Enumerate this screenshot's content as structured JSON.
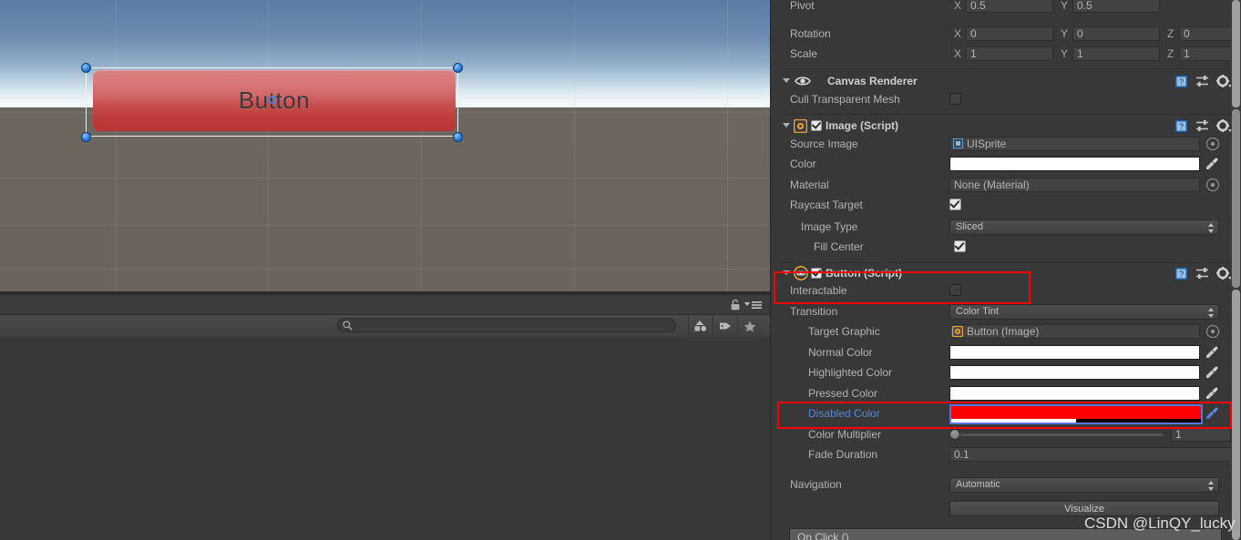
{
  "scene": {
    "object_label": "Button"
  },
  "project_panel": {
    "search_placeholder": "",
    "icons": {
      "search": "search-icon",
      "lock": "lock-icon",
      "menu": "hamburger-menu-icon",
      "filter_object": "filter-by-type-icon",
      "filter_label": "filter-by-label-icon",
      "filter_favorite": "favorite-star-icon"
    }
  },
  "inspector": {
    "transform": {
      "rows": [
        {
          "label": "Pivot",
          "fields": [
            {
              "axis": "X",
              "value": "0.5"
            },
            {
              "axis": "Y",
              "value": "0.5"
            }
          ]
        },
        {
          "label": "Rotation",
          "fields": [
            {
              "axis": "X",
              "value": "0"
            },
            {
              "axis": "Y",
              "value": "0"
            },
            {
              "axis": "Z",
              "value": "0"
            }
          ]
        },
        {
          "label": "Scale",
          "fields": [
            {
              "axis": "X",
              "value": "1"
            },
            {
              "axis": "Y",
              "value": "1"
            },
            {
              "axis": "Z",
              "value": "1"
            }
          ]
        }
      ]
    },
    "canvas_renderer": {
      "title": "Canvas Renderer",
      "icon": "eye-icon",
      "cull_transparent_mesh": {
        "label": "Cull Transparent Mesh",
        "checked": false
      }
    },
    "image_script": {
      "title": "Image (Script)",
      "enabled": true,
      "source_image": {
        "label": "Source Image",
        "value": "UISprite",
        "icon": "sprite-icon"
      },
      "color": {
        "label": "Color",
        "value": "#FFFFFF"
      },
      "material": {
        "label": "Material",
        "value": "None (Material)"
      },
      "raycast_target": {
        "label": "Raycast Target",
        "checked": true
      },
      "image_type": {
        "label": "Image Type",
        "value": "Sliced"
      },
      "fill_center": {
        "label": "Fill Center",
        "checked": true
      }
    },
    "button_script": {
      "title": "Button (Script)",
      "enabled": true,
      "interactable": {
        "label": "Interactable",
        "checked": false
      },
      "transition": {
        "label": "Transition",
        "value": "Color Tint"
      },
      "target_graphic": {
        "label": "Target Graphic",
        "value": "Button (Image)",
        "icon": "image-component-icon"
      },
      "normal_color": {
        "label": "Normal Color",
        "value": "#FFFFFF"
      },
      "highlighted_color": {
        "label": "Highlighted Color",
        "value": "#FFFFFF"
      },
      "pressed_color": {
        "label": "Pressed Color",
        "value": "#FFFFFF"
      },
      "disabled_color": {
        "label": "Disabled Color",
        "value": "#FF0000",
        "alpha_percent": 50,
        "selected": true
      },
      "color_multiplier": {
        "label": "Color Multiplier",
        "value": "1",
        "slider_percent": 0
      },
      "fade_duration": {
        "label": "Fade Duration",
        "value": "0.1"
      },
      "navigation": {
        "label": "Navigation",
        "value": "Automatic"
      },
      "visualize_button": "Visualize",
      "on_click": "On Click ()"
    },
    "header_icons": {
      "help": "help-book-icon",
      "preset": "preset-sliders-icon",
      "settings": "gear-icon"
    }
  },
  "watermark": "CSDN @LinQY_lucky",
  "colors": {
    "highlight_box": "#FF0000",
    "disabled_color_swatch": "#FF0000",
    "selection_border": "#5577DD",
    "link_label": "#5B84D6"
  }
}
